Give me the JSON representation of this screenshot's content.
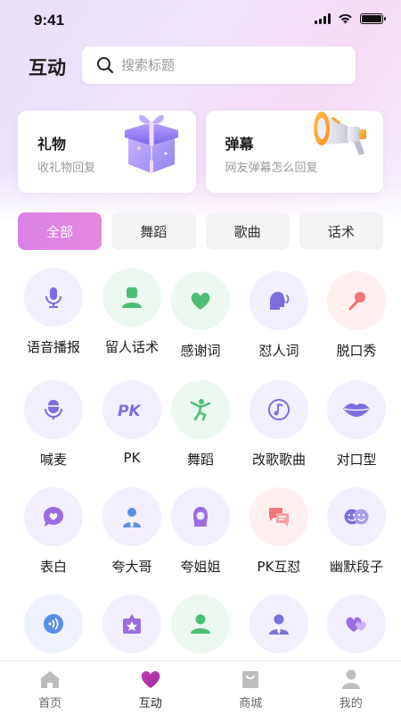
{
  "status": {
    "time": "9:41"
  },
  "header": {
    "title": "互动",
    "search_placeholder": "搜索标题"
  },
  "cards": [
    {
      "title": "礼物",
      "subtitle": "收礼物回复",
      "icon": "gift-box-icon"
    },
    {
      "title": "弹幕",
      "subtitle": "网友弹幕怎么回复",
      "icon": "megaphone-icon"
    }
  ],
  "tabs": [
    {
      "label": "全部",
      "active": true
    },
    {
      "label": "舞蹈",
      "active": false
    },
    {
      "label": "歌曲",
      "active": false
    },
    {
      "label": "话术",
      "active": false
    }
  ],
  "grid": [
    {
      "label": "语音播报",
      "icon": "microphone-icon",
      "color": "#7b6ee0"
    },
    {
      "label": "留人话术",
      "icon": "person-icon",
      "color": "#4bbf74"
    },
    {
      "label": "感谢词",
      "icon": "heart-icon",
      "color": "#4bbf74"
    },
    {
      "label": "怼人词",
      "icon": "speaking-head-icon",
      "color": "#7b6ee0"
    },
    {
      "label": "脱口秀",
      "icon": "handheld-mic-icon",
      "color": "#f07878"
    },
    {
      "label": "喊麦",
      "icon": "mic-capsule-icon",
      "color": "#7b6ee0"
    },
    {
      "label": "PK",
      "icon": "pk-icon",
      "color": "#7b6ee0"
    },
    {
      "label": "舞蹈",
      "icon": "dancer-icon",
      "color": "#4bbf74"
    },
    {
      "label": "改歌歌曲",
      "icon": "music-note-icon",
      "color": "#7b6ee0"
    },
    {
      "label": "对口型",
      "icon": "lips-icon",
      "color": "#7b6ee0"
    },
    {
      "label": "表白",
      "icon": "heart-bubble-icon",
      "color": "#9a6ee0"
    },
    {
      "label": "夸大哥",
      "icon": "gentleman-icon",
      "color": "#5a8fe8"
    },
    {
      "label": "夸姐姐",
      "icon": "lady-icon",
      "color": "#9a6ee0"
    },
    {
      "label": "PK互怼",
      "icon": "chat-bubbles-icon",
      "color": "#f07878"
    },
    {
      "label": "幽默段子",
      "icon": "smile-faces-icon",
      "color": "#7b6ee0"
    },
    {
      "label": "",
      "icon": "sound-wave-icon",
      "color": "#5a8fe8"
    },
    {
      "label": "",
      "icon": "star-gift-icon",
      "color": "#9a6ee0"
    },
    {
      "label": "",
      "icon": "person-icon",
      "color": "#4bbf74"
    },
    {
      "label": "",
      "icon": "suited-person-icon",
      "color": "#7b6ee0"
    },
    {
      "label": "",
      "icon": "double-heart-icon",
      "color": "#9a6ee0"
    }
  ],
  "tabbar": [
    {
      "label": "首页",
      "icon": "home-icon",
      "active": false
    },
    {
      "label": "互动",
      "icon": "heart-icon",
      "active": true
    },
    {
      "label": "商城",
      "icon": "shopping-bag-icon",
      "active": false
    },
    {
      "label": "我的",
      "icon": "user-icon",
      "active": false
    }
  ],
  "colors": {
    "accent": "#e283df",
    "tab_inactive_bg": "#f4f4f6"
  }
}
